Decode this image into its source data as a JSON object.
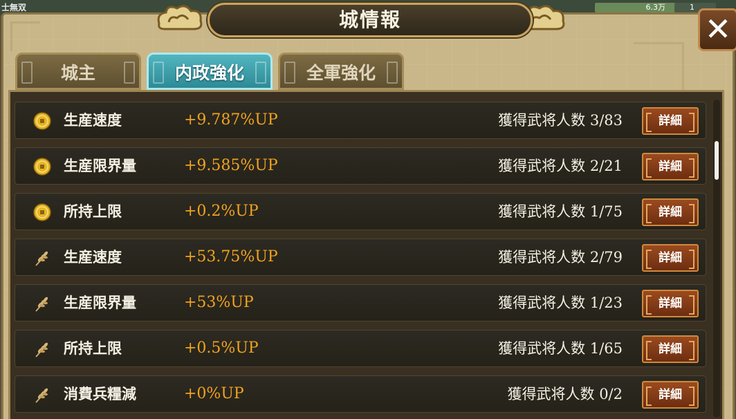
{
  "top_bar": {
    "game_name": "士無双",
    "resource_a": "6.3万",
    "resource_b": "1"
  },
  "window": {
    "title": "城情報",
    "close_label": "✕"
  },
  "tabs": [
    {
      "label": "城主",
      "active": false
    },
    {
      "label": "内政強化",
      "active": true
    },
    {
      "label": "全軍強化",
      "active": false
    }
  ],
  "rows": [
    {
      "icon": "coin-icon",
      "label": "生産速度",
      "value": "+9.787%UP",
      "count": "獲得武将人数 3/83",
      "button": "詳細"
    },
    {
      "icon": "coin-icon",
      "label": "生産限界量",
      "value": "+9.585%UP",
      "count": "獲得武将人数 2/21",
      "button": "詳細"
    },
    {
      "icon": "coin-icon",
      "label": "所持上限",
      "value": "+0.2%UP",
      "count": "獲得武将人数 1/75",
      "button": "詳細"
    },
    {
      "icon": "grain-icon",
      "label": "生産速度",
      "value": "+53.75%UP",
      "count": "獲得武将人数 2/79",
      "button": "詳細"
    },
    {
      "icon": "grain-icon",
      "label": "生産限界量",
      "value": "+53%UP",
      "count": "獲得武将人数 1/23",
      "button": "詳細"
    },
    {
      "icon": "grain-icon",
      "label": "所持上限",
      "value": "+0.5%UP",
      "count": "獲得武将人数 1/65",
      "button": "詳細"
    },
    {
      "icon": "grain-icon",
      "label": "消費兵糧減",
      "value": "+0%UP",
      "count": "獲得武将人数 0/2",
      "button": "詳細"
    }
  ],
  "colors": {
    "value_text": "#f2a21e",
    "active_tab": "#3fa3ad",
    "detail_button": "#8a3f18"
  }
}
